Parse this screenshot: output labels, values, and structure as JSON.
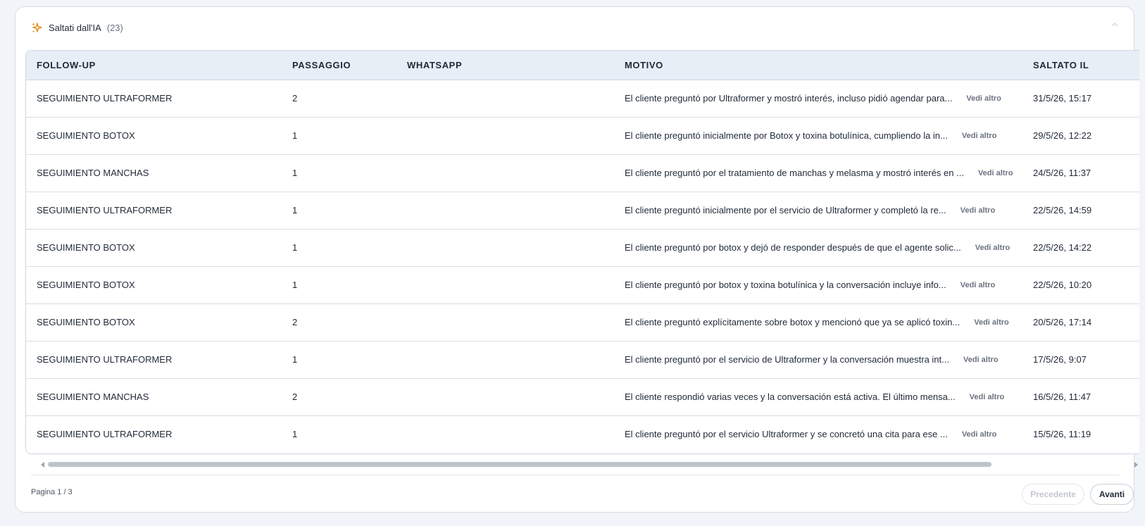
{
  "panel": {
    "title": "Saltati dall'IA",
    "count": "(23)"
  },
  "table": {
    "columns": [
      "FOLLOW-UP",
      "PASSAGGIO",
      "WHATSAPP",
      "MOTIVO",
      "SALTATO IL"
    ],
    "rows": [
      {
        "followup": "SEGUIMIENTO ULTRAFORMER",
        "step": "2",
        "whatsapp": "",
        "reason": "El cliente preguntó por Ultraformer y mostró interés, incluso pidió agendar para...",
        "more": "Vedi altro",
        "date": "31/5/26, 15:17"
      },
      {
        "followup": "SEGUIMIENTO BOTOX",
        "step": "1",
        "whatsapp": "",
        "reason": "El cliente preguntó inicialmente por Botox y toxina botulínica, cumpliendo la in...",
        "more": "Vedi altro",
        "date": "29/5/26, 12:22"
      },
      {
        "followup": "SEGUIMIENTO MANCHAS",
        "step": "1",
        "whatsapp": "",
        "reason": "El cliente preguntó por el tratamiento de manchas y melasma y mostró interés en ...",
        "more": "Vedi altro",
        "date": "24/5/26, 11:37"
      },
      {
        "followup": "SEGUIMIENTO ULTRAFORMER",
        "step": "1",
        "whatsapp": "",
        "reason": "El cliente preguntó inicialmente por el servicio de Ultraformer y completó la re...",
        "more": "Vedi altro",
        "date": "22/5/26, 14:59"
      },
      {
        "followup": "SEGUIMIENTO BOTOX",
        "step": "1",
        "whatsapp": "",
        "reason": "El cliente preguntó por botox y dejó de responder después de que el agente solic...",
        "more": "Vedi altro",
        "date": "22/5/26, 14:22"
      },
      {
        "followup": "SEGUIMIENTO BOTOX",
        "step": "1",
        "whatsapp": "",
        "reason": "El cliente preguntó por botox y toxina botulínica y la conversación incluye info...",
        "more": "Vedi altro",
        "date": "22/5/26, 10:20"
      },
      {
        "followup": "SEGUIMIENTO BOTOX",
        "step": "2",
        "whatsapp": "",
        "reason": "El cliente preguntó explícitamente sobre botox y mencionó que ya se aplicó toxin...",
        "more": "Vedi altro",
        "date": "20/5/26, 17:14"
      },
      {
        "followup": "SEGUIMIENTO ULTRAFORMER",
        "step": "1",
        "whatsapp": "",
        "reason": "El cliente preguntó por el servicio de Ultraformer y la conversación muestra int...",
        "more": "Vedi altro",
        "date": "17/5/26, 9:07"
      },
      {
        "followup": "SEGUIMIENTO MANCHAS",
        "step": "2",
        "whatsapp": "",
        "reason": "El cliente respondió varias veces y la conversación está activa. El último mensa...",
        "more": "Vedi altro",
        "date": "16/5/26, 11:47"
      },
      {
        "followup": "SEGUIMIENTO ULTRAFORMER",
        "step": "1",
        "whatsapp": "",
        "reason": "El cliente preguntó por el servicio Ultraformer y se concretó una cita para ese ...",
        "more": "Vedi altro",
        "date": "15/5/26, 11:19"
      }
    ]
  },
  "pagination": {
    "info": "Pagina 1 / 3",
    "prev_label": "Precedente",
    "next_label": "Avanti"
  },
  "colors": {
    "accent_icon": "#e08a1e",
    "header_bg": "#e7eef6",
    "page_bg": "#f1f4f8"
  },
  "icons": {
    "title_icon": "sparkles-icon",
    "collapse_icon": "chevron-up-icon"
  }
}
